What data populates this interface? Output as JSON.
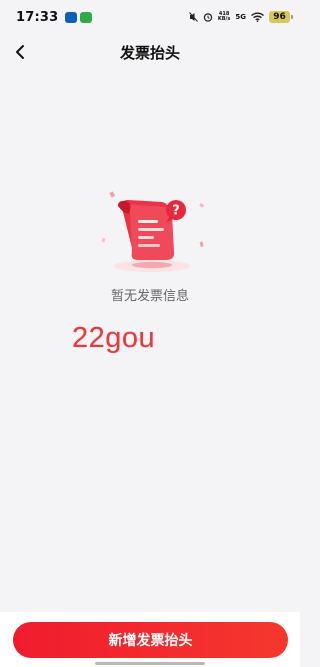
{
  "status_bar": {
    "time": "17:33",
    "net_speed_value": "418",
    "net_speed_unit": "KB/s",
    "network_type": "5G",
    "battery": "96"
  },
  "header": {
    "title": "发票抬头"
  },
  "empty_state": {
    "message": "暂无发票信息"
  },
  "watermark": {
    "text": "22gou"
  },
  "footer": {
    "add_button_label": "新增发票抬头"
  },
  "colors": {
    "accent": "#f01c2e",
    "background": "#f4f4f6",
    "watermark": "#e53b3b"
  },
  "icons": [
    "back-arrow-icon",
    "mute-icon",
    "alarm-icon",
    "wifi-icon",
    "battery-icon",
    "invoice-empty-illustration",
    "question-bubble-icon"
  ]
}
